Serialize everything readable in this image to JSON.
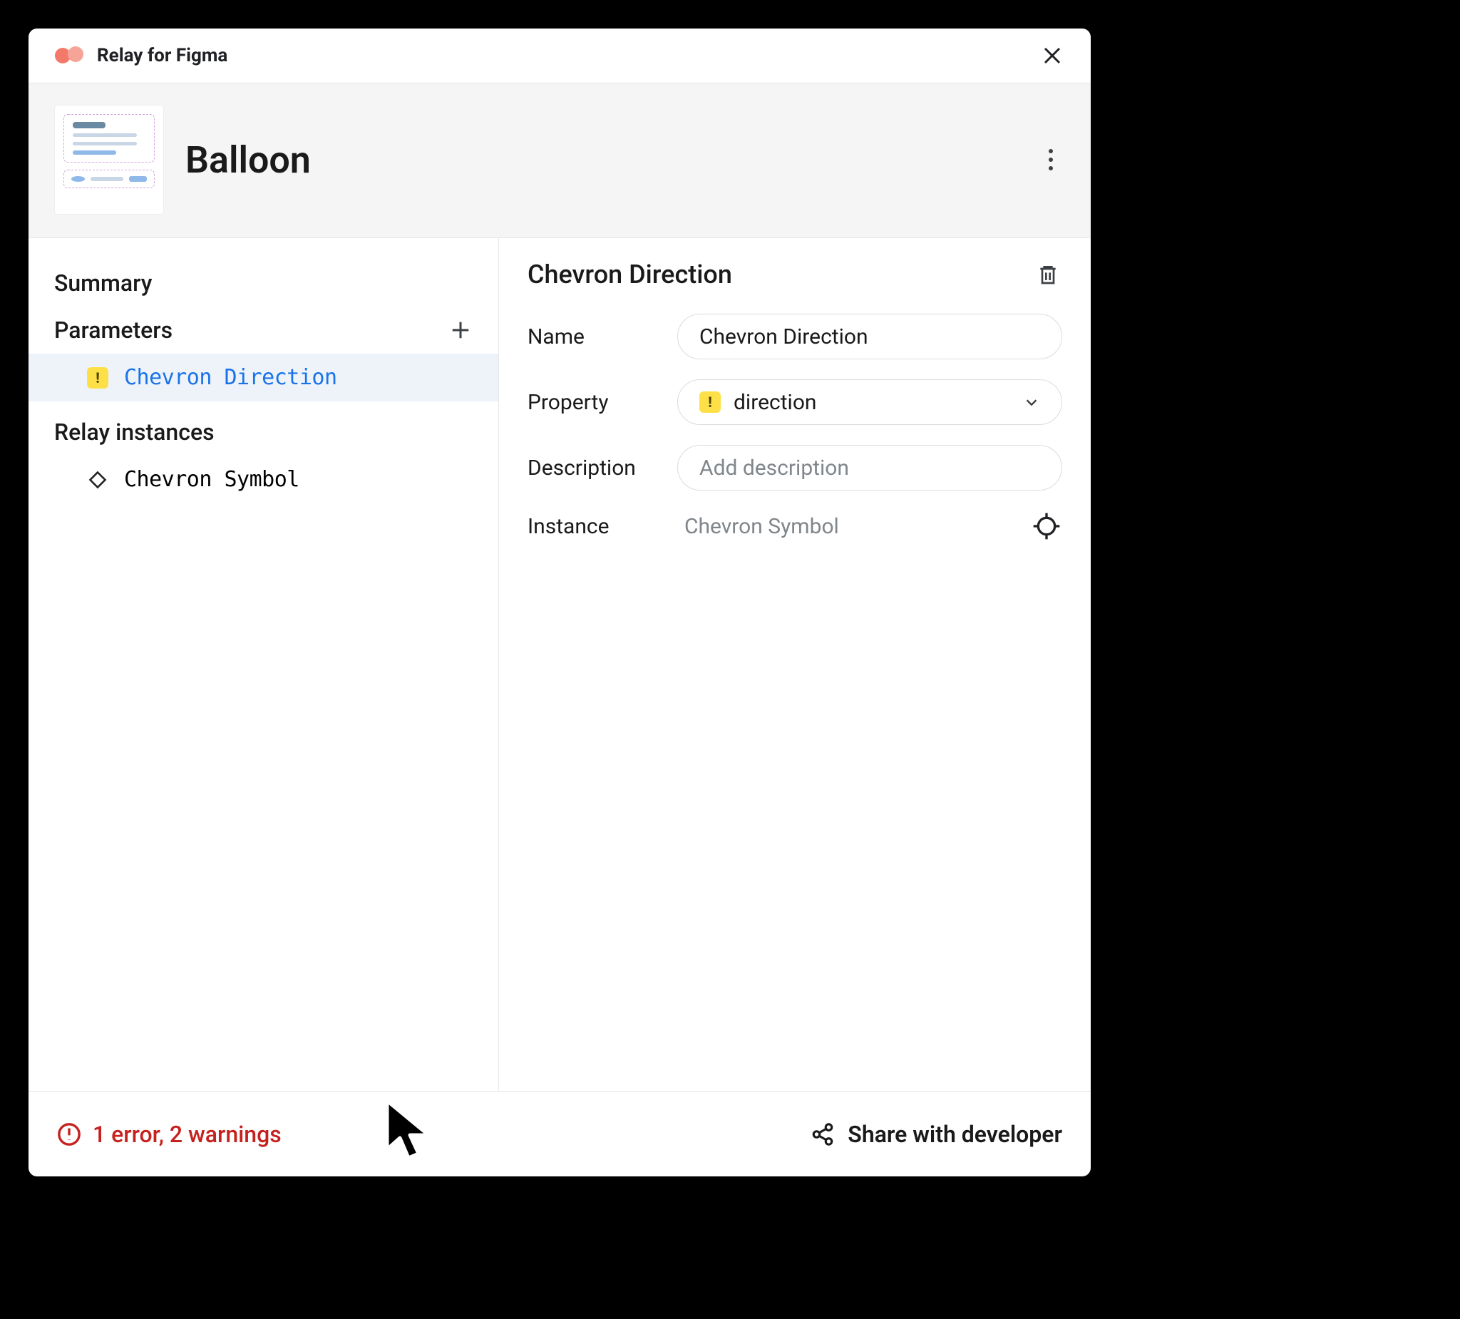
{
  "titlebar": {
    "title": "Relay for Figma"
  },
  "header": {
    "component_name": "Balloon"
  },
  "sidebar": {
    "summary_label": "Summary",
    "parameters_label": "Parameters",
    "relay_instances_label": "Relay instances",
    "parameters": [
      {
        "label": "Chevron Direction",
        "has_warning": true
      }
    ],
    "instances": [
      {
        "label": "Chevron Symbol"
      }
    ]
  },
  "detail": {
    "title": "Chevron Direction",
    "name_label": "Name",
    "name_value": "Chevron Direction",
    "property_label": "Property",
    "property_value": "direction",
    "property_has_warning": true,
    "description_label": "Description",
    "description_placeholder": "Add description",
    "instance_label": "Instance",
    "instance_value": "Chevron Symbol"
  },
  "footer": {
    "errors_text": "1 error, 2 warnings",
    "share_label": "Share with developer"
  }
}
